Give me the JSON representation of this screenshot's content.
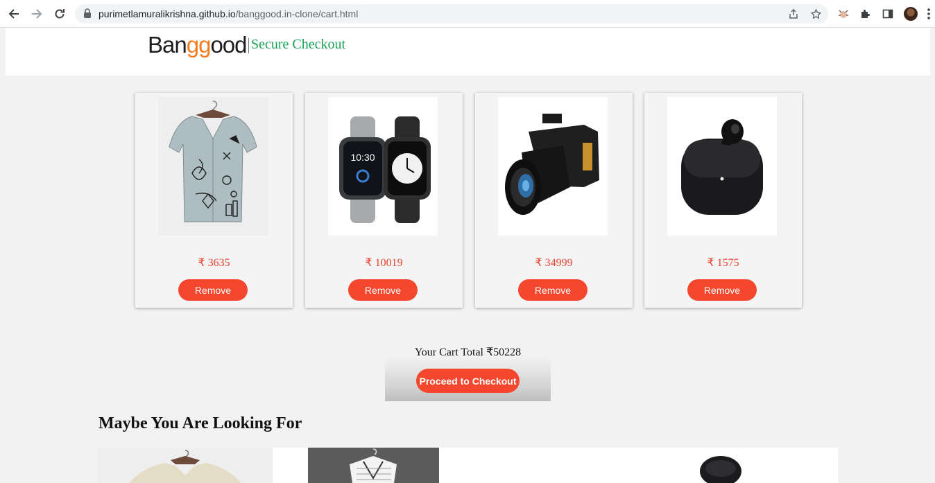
{
  "browser": {
    "url_host": "purimetlamuralikrishna.github.io",
    "url_path": "/banggood.in-clone/cart.html"
  },
  "header": {
    "logo_part1": "Ban",
    "logo_part2": "gg",
    "logo_part3": "ood",
    "subtitle": "Secure Checkout"
  },
  "cart": {
    "items": [
      {
        "name": "shirt",
        "price": "₹ 3635",
        "remove_label": "Remove"
      },
      {
        "name": "smartwatch",
        "price": "₹ 10019",
        "remove_label": "Remove"
      },
      {
        "name": "camera",
        "price": "₹ 34999",
        "remove_label": "Remove"
      },
      {
        "name": "earbuds",
        "price": "₹ 1575",
        "remove_label": "Remove"
      }
    ],
    "total_text": "Your Cart Total ₹50228",
    "checkout_label": "Proceed to Checkout"
  },
  "suggestions": {
    "heading": "Maybe You Are Looking For"
  },
  "colors": {
    "accent": "#f4472e",
    "price": "#e8412c",
    "secure_green": "#18a153",
    "logo_orange": "#f47c20"
  }
}
